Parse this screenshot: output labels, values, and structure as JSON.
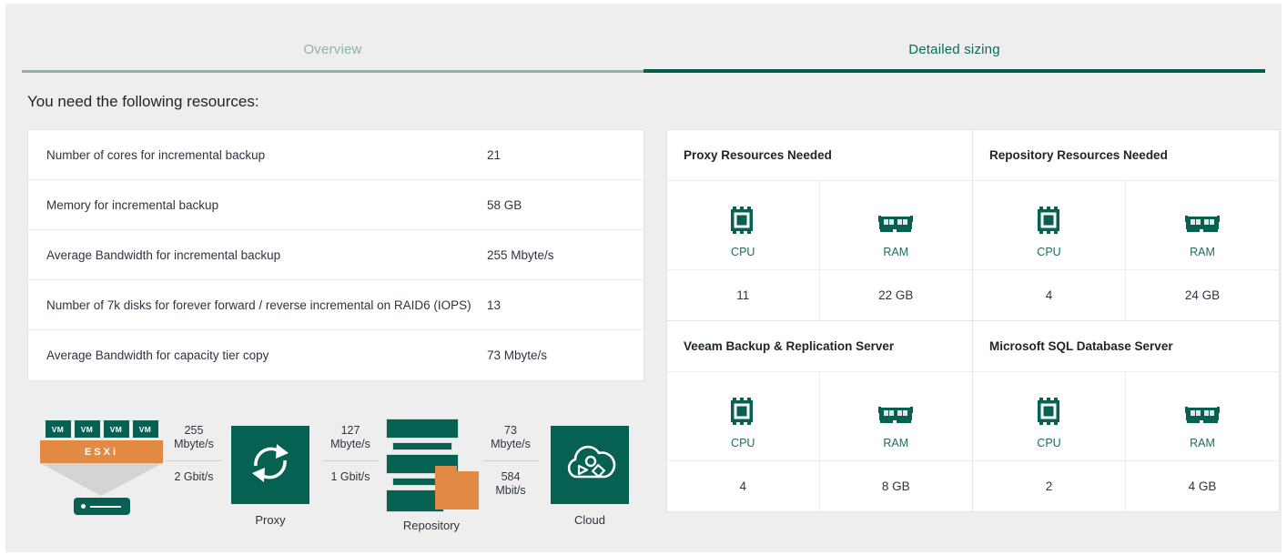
{
  "tabs": [
    {
      "label": "Overview",
      "active": false
    },
    {
      "label": "Detailed sizing",
      "active": true
    }
  ],
  "heading": "You need the following resources:",
  "summary": {
    "rows": [
      {
        "label": "Number of cores for incremental backup",
        "value": "21"
      },
      {
        "label": "Memory for incremental backup",
        "value": "58 GB"
      },
      {
        "label": "Average Bandwidth for incremental backup",
        "value": "255 Mbyte/s"
      },
      {
        "label": "Number of 7k disks for forever forward / reverse incremental on RAID6 (IOPS)",
        "value": "13"
      },
      {
        "label": "Average Bandwidth for capacity tier copy",
        "value": "73 Mbyte/s"
      }
    ]
  },
  "resources": {
    "cards": [
      {
        "title": "Proxy Resources Needed",
        "cpu_label": "CPU",
        "cpu_value": "11",
        "ram_label": "RAM",
        "ram_value": "22 GB"
      },
      {
        "title": "Repository Resources Needed",
        "cpu_label": "CPU",
        "cpu_value": "4",
        "ram_label": "RAM",
        "ram_value": "24 GB"
      },
      {
        "title": "Veeam Backup & Replication Server",
        "cpu_label": "CPU",
        "cpu_value": "4",
        "ram_label": "RAM",
        "ram_value": "8 GB"
      },
      {
        "title": "Microsoft SQL Database Server",
        "cpu_label": "CPU",
        "cpu_value": "2",
        "ram_label": "RAM",
        "ram_value": "4 GB"
      }
    ]
  },
  "flow": {
    "esxi": {
      "vm_labels": [
        "VM",
        "VM",
        "VM",
        "VM"
      ],
      "hypervisor_label": "ESXi"
    },
    "links": [
      {
        "throughput": "255\nMbyte/s",
        "top_line1": "255",
        "top_line2": "Mbyte/s",
        "bottom": "2 Gbit/s"
      },
      {
        "throughput": "127\nMbyte/s",
        "top_line1": "127",
        "top_line2": "Mbyte/s",
        "bottom": "1 Gbit/s"
      },
      {
        "throughput": "73\nMbyte/s",
        "top_line1": "73",
        "top_line2": "Mbyte/s",
        "bottom_line1": "584",
        "bottom_line2": "Mbit/s"
      }
    ],
    "proxy_caption": "Proxy",
    "repository_caption": "Repository",
    "cloud_caption": "Cloud"
  },
  "colors": {
    "brand_green": "#066152",
    "accent_orange": "#e28a43",
    "active_tab": "#045c4a",
    "inactive_tab": "#8fb2a6",
    "panel_bg": "#eeeeee"
  }
}
